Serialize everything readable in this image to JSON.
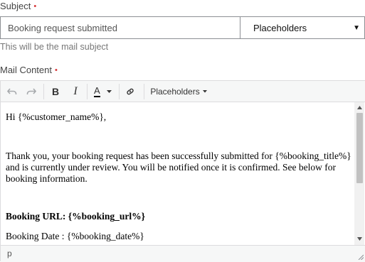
{
  "subject": {
    "label": "Subject",
    "required_mark": "•",
    "value": "Booking request submitted",
    "placeholders_label": "Placeholders",
    "caret": "▼",
    "hint": "This will be the mail subject"
  },
  "mail_content": {
    "label": "Mail Content",
    "required_mark": "•"
  },
  "toolbar": {
    "undo_icon": "undo-icon",
    "redo_icon": "redo-icon",
    "bold": "B",
    "italic": "I",
    "text_color": "A",
    "link_icon": "link-icon",
    "placeholders": "Placeholders"
  },
  "body": {
    "greeting": "Hi {%customer_name%},",
    "paragraph": "Thank you, your booking request has been successfully submitted for {%booking_title%} and is currently under review. You will be notified once it is confirmed. See below for booking information.",
    "booking_url": "Booking URL: {%booking_url%}",
    "booking_date": "Booking Date : {%booking_date%}"
  },
  "statusbar": {
    "path": "p"
  },
  "colors": {
    "required": "#d63638",
    "toolbar_bg": "#f6f7f7",
    "border": "#8c8f94",
    "text_color_underline": "#000000"
  }
}
